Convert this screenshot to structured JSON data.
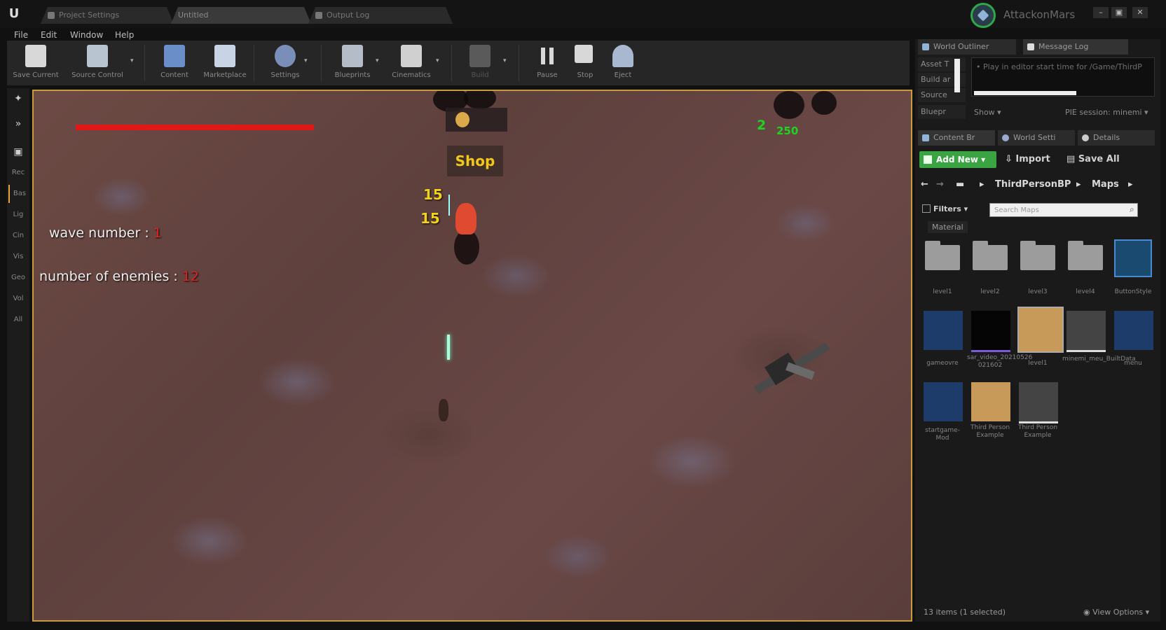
{
  "titlebar": {
    "logo": "U",
    "tabs": [
      "Project Settings",
      "Untitled",
      "Output Log"
    ],
    "project_name": "AttackonMars",
    "window_controls": [
      "–",
      "▣",
      "✕"
    ]
  },
  "menu": [
    "File",
    "Edit",
    "Window",
    "Help"
  ],
  "toolbar": [
    {
      "label": "Save Current",
      "icon": "save-icon"
    },
    {
      "label": "Source Control",
      "icon": "source-control-icon"
    },
    {
      "label": "Content",
      "icon": "content-icon"
    },
    {
      "label": "Marketplace",
      "icon": "marketplace-icon"
    },
    {
      "label": "Settings",
      "icon": "settings-icon"
    },
    {
      "label": "Blueprints",
      "icon": "blueprints-icon"
    },
    {
      "label": "Cinematics",
      "icon": "cinematics-icon"
    },
    {
      "label": "Build",
      "icon": "build-icon"
    },
    {
      "label": "Pause",
      "icon": "pause-icon"
    },
    {
      "label": "Stop",
      "icon": "stop-icon"
    },
    {
      "label": "Eject",
      "icon": "eject-icon"
    }
  ],
  "modes": [
    "Rec",
    "Bas",
    "Lig",
    "Cin",
    "Vis",
    "Geo",
    "Vol",
    "All"
  ],
  "hud": {
    "wave_label": "wave number :",
    "wave_value": "1",
    "enemies_label": "number of enemies :",
    "enemies_value": "12",
    "shop_label": "Shop",
    "damage_1": "15",
    "damage_2": "15",
    "score_count": "2",
    "score_money": "250",
    "health_fraction": 1.0
  },
  "panels": {
    "top_tabs": [
      "World Outliner",
      "Message Log"
    ],
    "message_text": "Play in editor start time for /Game/ThirdP",
    "left_items": [
      "Asset T",
      "Build ar",
      "Source",
      "Bluepr"
    ],
    "show_label": "Show ▾",
    "pie_label": "PIE session: minemi ▾",
    "bottom_tabs": [
      "Content Br",
      "World Setti",
      "Details"
    ],
    "add_new": "Add New ▾",
    "import": "Import",
    "save_all": "Save All",
    "breadcrumbs": [
      "ThirdPersonBP",
      "Maps"
    ],
    "filters": "Filters ▾",
    "search_placeholder": "Search Maps",
    "material_tag": "Material",
    "assets_row1": [
      "level1",
      "level2",
      "level3",
      "level4",
      "ButtonStyle"
    ],
    "assets_row2": [
      "gameovre",
      "sar_video_20210526 021602",
      "level1",
      "minemi_meu_BuiltData",
      "menu"
    ],
    "assets_row3": [
      "startgame-Mod",
      "Third Person Example",
      "Third Person Example"
    ],
    "status": "13 items (1 selected)",
    "view_options": "View Options ▾"
  }
}
